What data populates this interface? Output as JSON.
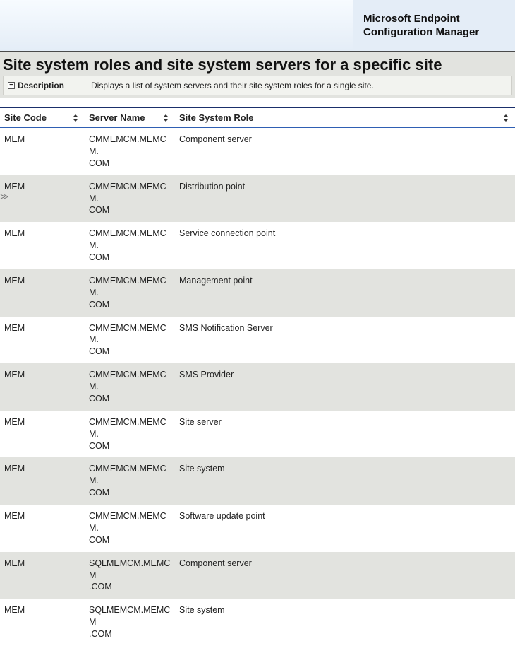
{
  "brand": {
    "line1": "Microsoft Endpoint",
    "line2": "Configuration Manager"
  },
  "page": {
    "title": "Site system roles and site system servers for a specific site",
    "description_label": "Description",
    "description_text": "Displays a list of system servers and their site system roles for a single site."
  },
  "columns": {
    "site_code": "Site Code",
    "server_name": "Server Name",
    "site_system_role": "Site System Role"
  },
  "rows": [
    {
      "site_code": "MEM",
      "server_name": "CMMEMCM.MEMCM.COM",
      "role": "Component server",
      "marker": ""
    },
    {
      "site_code": "MEM",
      "server_name": "CMMEMCM.MEMCM.COM",
      "role": "Distribution point",
      "marker": ">>"
    },
    {
      "site_code": "MEM",
      "server_name": "CMMEMCM.MEMCM.COM",
      "role": "Service connection point",
      "marker": ""
    },
    {
      "site_code": "MEM",
      "server_name": "CMMEMCM.MEMCM.COM",
      "role": "Management point",
      "marker": ""
    },
    {
      "site_code": "MEM",
      "server_name": "CMMEMCM.MEMCM.COM",
      "role": "SMS Notification Server",
      "marker": ""
    },
    {
      "site_code": "MEM",
      "server_name": "CMMEMCM.MEMCM.COM",
      "role": "SMS Provider",
      "marker": ""
    },
    {
      "site_code": "MEM",
      "server_name": "CMMEMCM.MEMCM.COM",
      "role": "Site server",
      "marker": ""
    },
    {
      "site_code": "MEM",
      "server_name": "CMMEMCM.MEMCM.COM",
      "role": "Site system",
      "marker": ""
    },
    {
      "site_code": "MEM",
      "server_name": "CMMEMCM.MEMCM.COM",
      "role": "Software update point",
      "marker": ""
    },
    {
      "site_code": "MEM",
      "server_name": "SQLMEMCM.MEMCM.COM",
      "role": "Component server",
      "marker": ""
    },
    {
      "site_code": "MEM",
      "server_name": "SQLMEMCM.MEMCM.COM",
      "role": "Site system",
      "marker": ""
    }
  ]
}
